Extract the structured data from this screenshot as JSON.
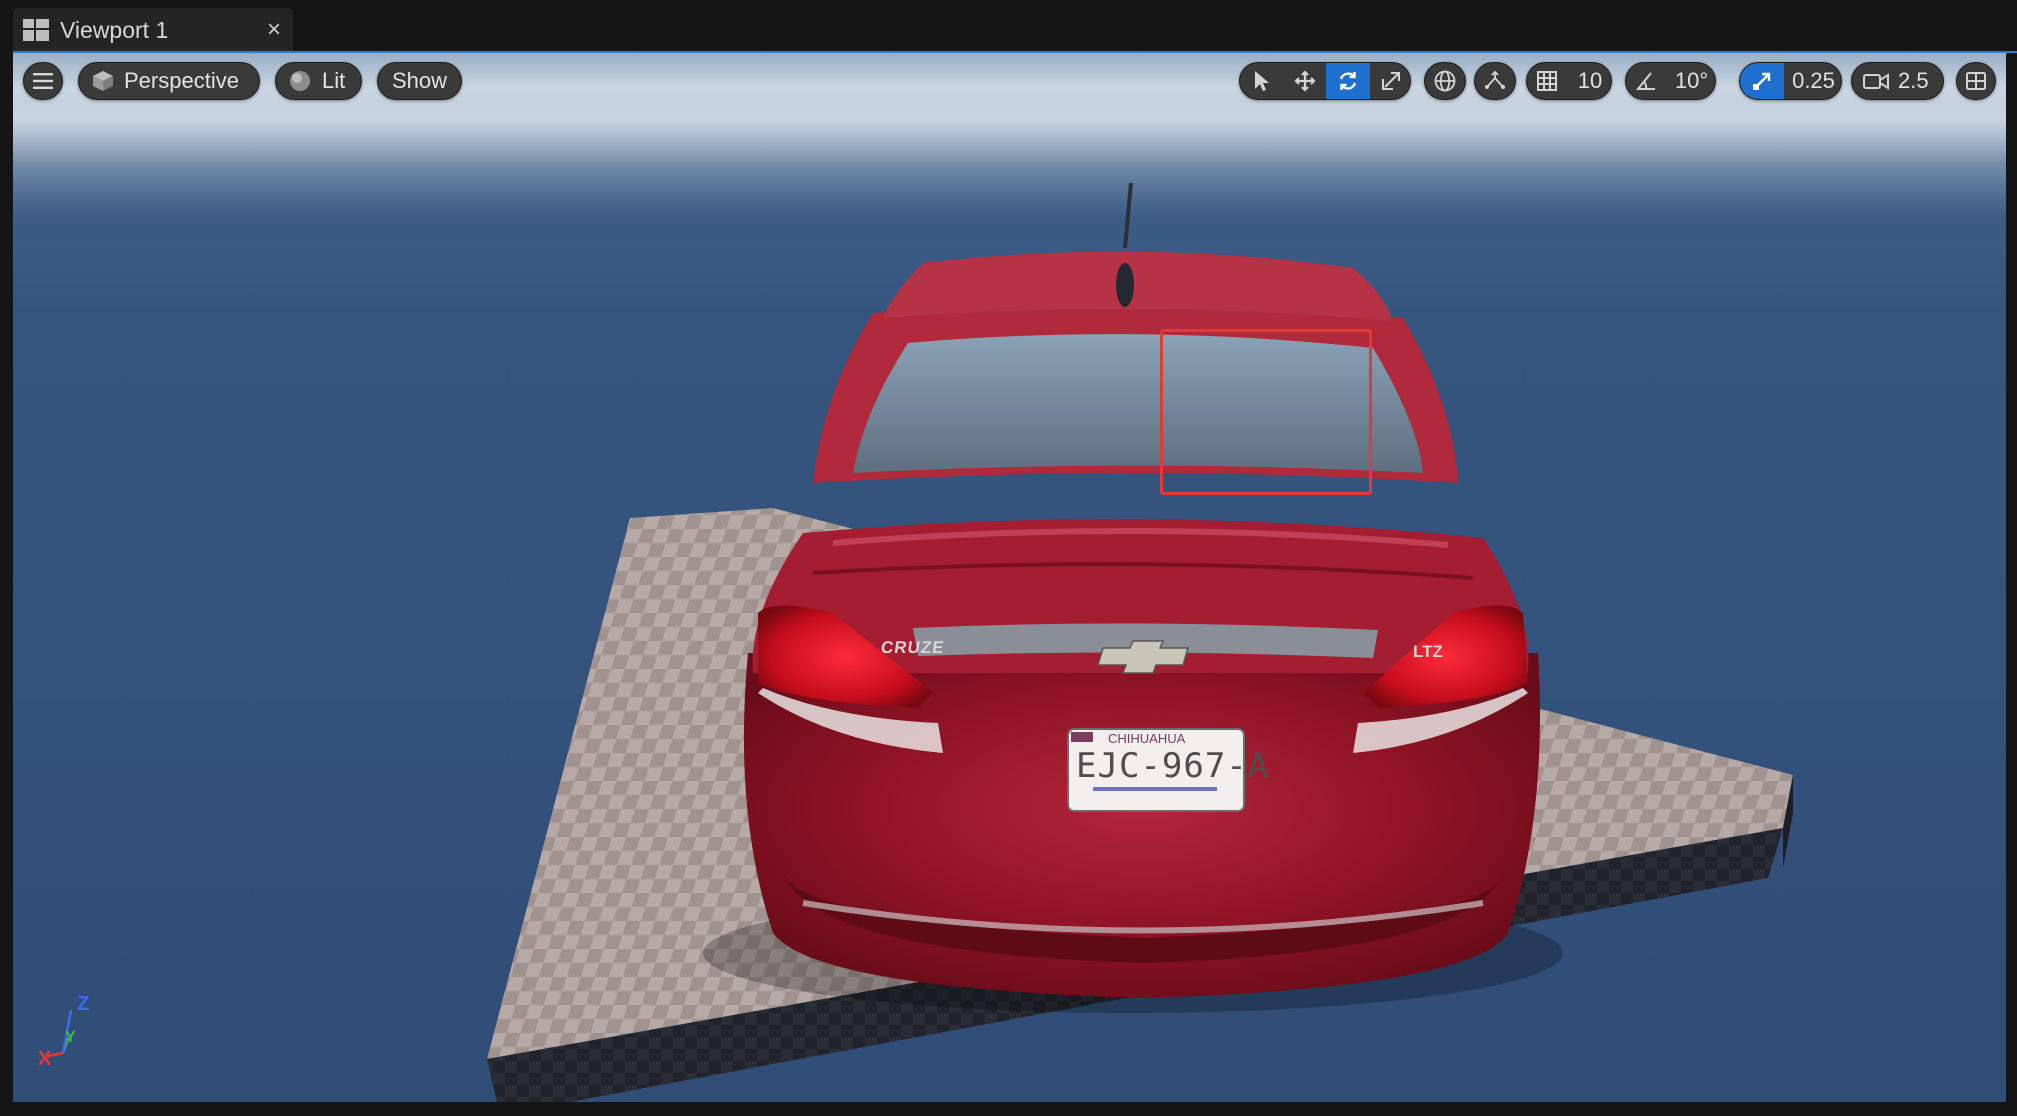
{
  "tab": {
    "title": "Viewport 1",
    "close_glyph": "×",
    "icon": "viewport-layout-icon"
  },
  "toolbar": {
    "menu_icon": "hamburger-icon",
    "perspective_label": "Perspective",
    "perspective_icon": "cube-icon",
    "lit_label": "Lit",
    "lit_icon": "sphere-icon",
    "show_label": "Show",
    "transform_tools": [
      "select-icon",
      "translate-icon",
      "rotate-icon",
      "scale-icon"
    ],
    "active_transform_tool": "rotate-icon",
    "coordinate_space_icon": "globe-icon",
    "surface_snap_icon": "surface-snap-icon",
    "grid_snap_value": "10",
    "rotation_snap_value": "10°",
    "scale_snap_value": "0.25",
    "camera_speed_value": "2.5",
    "layout_icon": "viewport-layout-icon"
  },
  "scene": {
    "license_plate_region": "CHIHUAHUA",
    "license_plate_number": "EJC-967-A",
    "badge_left": "CRUZE",
    "badge_right": "LTZ"
  },
  "axis_gizmo": {
    "x": "X",
    "y": "Y",
    "z": "Z"
  },
  "colors": {
    "accent_blue": "#1f6fd1",
    "selection_red": "#e03a3a",
    "toolbar_bg": "#3a3a3a"
  }
}
